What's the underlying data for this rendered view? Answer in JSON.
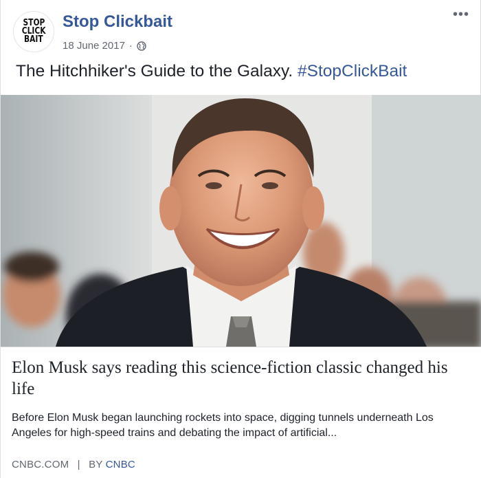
{
  "page": {
    "avatar_lines": [
      "STOP",
      "CLICK",
      "BAIT"
    ],
    "name": "Stop Clickbait",
    "date": "18 June 2017",
    "separator": "·",
    "privacy_icon": "globe-icon",
    "more_label": "•••"
  },
  "post": {
    "text": "The Hitchhiker's Guide to the Galaxy.",
    "hashtag": "#StopClickBait"
  },
  "link_preview": {
    "headline": "Elon Musk says reading this science-fiction classic changed his life",
    "description": "Before Elon Musk began launching rockets into space, digging tunnels underneath Los Angeles for high-speed trains and debating the impact of artificial...",
    "domain": "CNBC.COM",
    "by_separator": "|",
    "by_prefix": "BY",
    "by_name": "CNBC"
  },
  "colors": {
    "link_blue": "#365899",
    "meta_gray": "#616770",
    "text": "#1d2129"
  }
}
